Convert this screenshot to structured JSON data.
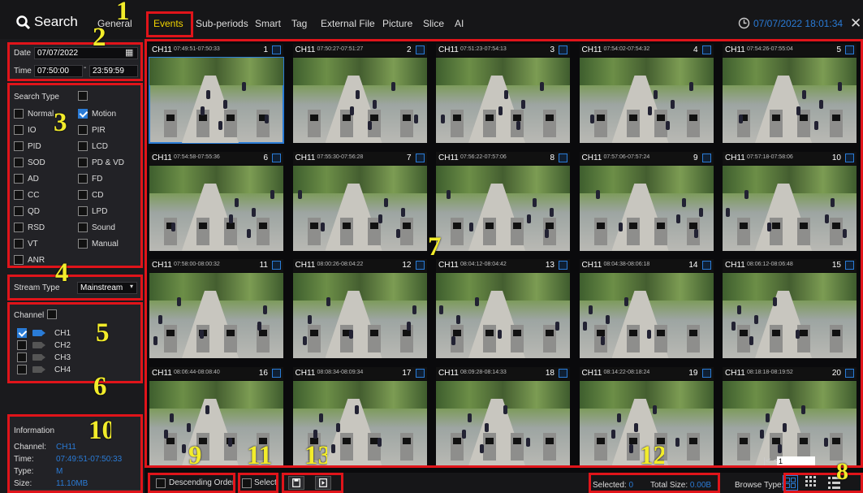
{
  "app_title": "Search",
  "tabs": [
    {
      "label": "General"
    },
    {
      "label": "Events"
    },
    {
      "label": "Sub-periods"
    },
    {
      "label": "Smart"
    },
    {
      "label": "Tag"
    },
    {
      "label": "External File"
    },
    {
      "label": "Picture"
    },
    {
      "label": "Slice"
    },
    {
      "label": "AI"
    }
  ],
  "active_tab": "Events",
  "datetime": "07/07/2022 18:01:34",
  "date": {
    "label": "Date",
    "value": "07/07/2022"
  },
  "time": {
    "label": "Time",
    "start": "07:50:00",
    "sep": "-",
    "end": "23:59:59"
  },
  "search_type": {
    "label": "Search Type",
    "options": [
      {
        "label": "Normal",
        "checked": false
      },
      {
        "label": "Motion",
        "checked": true
      },
      {
        "label": "IO",
        "checked": false
      },
      {
        "label": "PIR",
        "checked": false
      },
      {
        "label": "PID",
        "checked": false
      },
      {
        "label": "LCD",
        "checked": false
      },
      {
        "label": "SOD",
        "checked": false
      },
      {
        "label": "PD & VD",
        "checked": false
      },
      {
        "label": "AD",
        "checked": false
      },
      {
        "label": "FD",
        "checked": false
      },
      {
        "label": "CC",
        "checked": false
      },
      {
        "label": "CD",
        "checked": false
      },
      {
        "label": "QD",
        "checked": false
      },
      {
        "label": "LPD",
        "checked": false
      },
      {
        "label": "RSD",
        "checked": false
      },
      {
        "label": "Sound",
        "checked": false
      },
      {
        "label": "VT",
        "checked": false
      },
      {
        "label": "Manual",
        "checked": false
      },
      {
        "label": "ANR",
        "checked": false
      }
    ]
  },
  "stream_type": {
    "label": "Stream Type",
    "value": "Mainstream"
  },
  "channel": {
    "label": "Channel",
    "items": [
      {
        "label": "CH1",
        "checked": true
      },
      {
        "label": "CH2",
        "checked": false
      },
      {
        "label": "CH3",
        "checked": false
      },
      {
        "label": "CH4",
        "checked": false
      }
    ]
  },
  "information": {
    "title": "Information",
    "rows": [
      {
        "label": "Channel:",
        "value": "CH11"
      },
      {
        "label": "Time:",
        "value": "07:49:51-07:50:33"
      },
      {
        "label": "Type:",
        "value": "M"
      },
      {
        "label": "Size:",
        "value": "11.10MB"
      }
    ]
  },
  "thumbnails": [
    {
      "ch": "CH11",
      "time": "07:49:51-07:50:33",
      "num": "1"
    },
    {
      "ch": "CH11",
      "time": "07:50:27-07:51:27",
      "num": "2"
    },
    {
      "ch": "CH11",
      "time": "07:51:23-07:54:13",
      "num": "3"
    },
    {
      "ch": "CH11",
      "time": "07:54:02-07:54:32",
      "num": "4"
    },
    {
      "ch": "CH11",
      "time": "07:54:26-07:55:04",
      "num": "5"
    },
    {
      "ch": "CH11",
      "time": "07:54:58-07:55:36",
      "num": "6"
    },
    {
      "ch": "CH11",
      "time": "07:55:30-07:56:28",
      "num": "7"
    },
    {
      "ch": "CH11",
      "time": "07:56:22-07:57:06",
      "num": "8"
    },
    {
      "ch": "CH11",
      "time": "07:57:06-07:57:24",
      "num": "9"
    },
    {
      "ch": "CH11",
      "time": "07:57:18-07:58:06",
      "num": "10"
    },
    {
      "ch": "CH11",
      "time": "07:58:00-08:00:32",
      "num": "11"
    },
    {
      "ch": "CH11",
      "time": "08:00:26-08:04:22",
      "num": "12"
    },
    {
      "ch": "CH11",
      "time": "08:04:12-08:04:42",
      "num": "13"
    },
    {
      "ch": "CH11",
      "time": "08:04:38-08:06:18",
      "num": "14"
    },
    {
      "ch": "CH11",
      "time": "08:06:12-08:06:48",
      "num": "15"
    },
    {
      "ch": "CH11",
      "time": "08:06:44-08:08:40",
      "num": "16"
    },
    {
      "ch": "CH11",
      "time": "08:08:34-08:09:34",
      "num": "17"
    },
    {
      "ch": "CH11",
      "time": "08:09:28-08:14:33",
      "num": "18"
    },
    {
      "ch": "CH11",
      "time": "08:14:22-08:18:24",
      "num": "19"
    },
    {
      "ch": "CH11",
      "time": "08:18:18-08:19:52",
      "num": "20"
    }
  ],
  "pager": {
    "prev": "|< <",
    "page": "1"
  },
  "footer": {
    "descending_order": "Descending Order",
    "select": "Select",
    "selected_label": "Selected:",
    "selected_value": "0",
    "total_size_label": "Total Size:",
    "total_size_value": "0.00B",
    "browse_type": "Browse Type:"
  },
  "annotations": [
    "1",
    "2",
    "3",
    "4",
    "5",
    "6",
    "7",
    "8",
    "9",
    "10",
    "11",
    "12",
    "13"
  ],
  "colors": {
    "accent": "#2a7bd6",
    "highlight": "#e0141a",
    "annotation": "#f2ec2a",
    "active_tab": "#f2d400"
  }
}
